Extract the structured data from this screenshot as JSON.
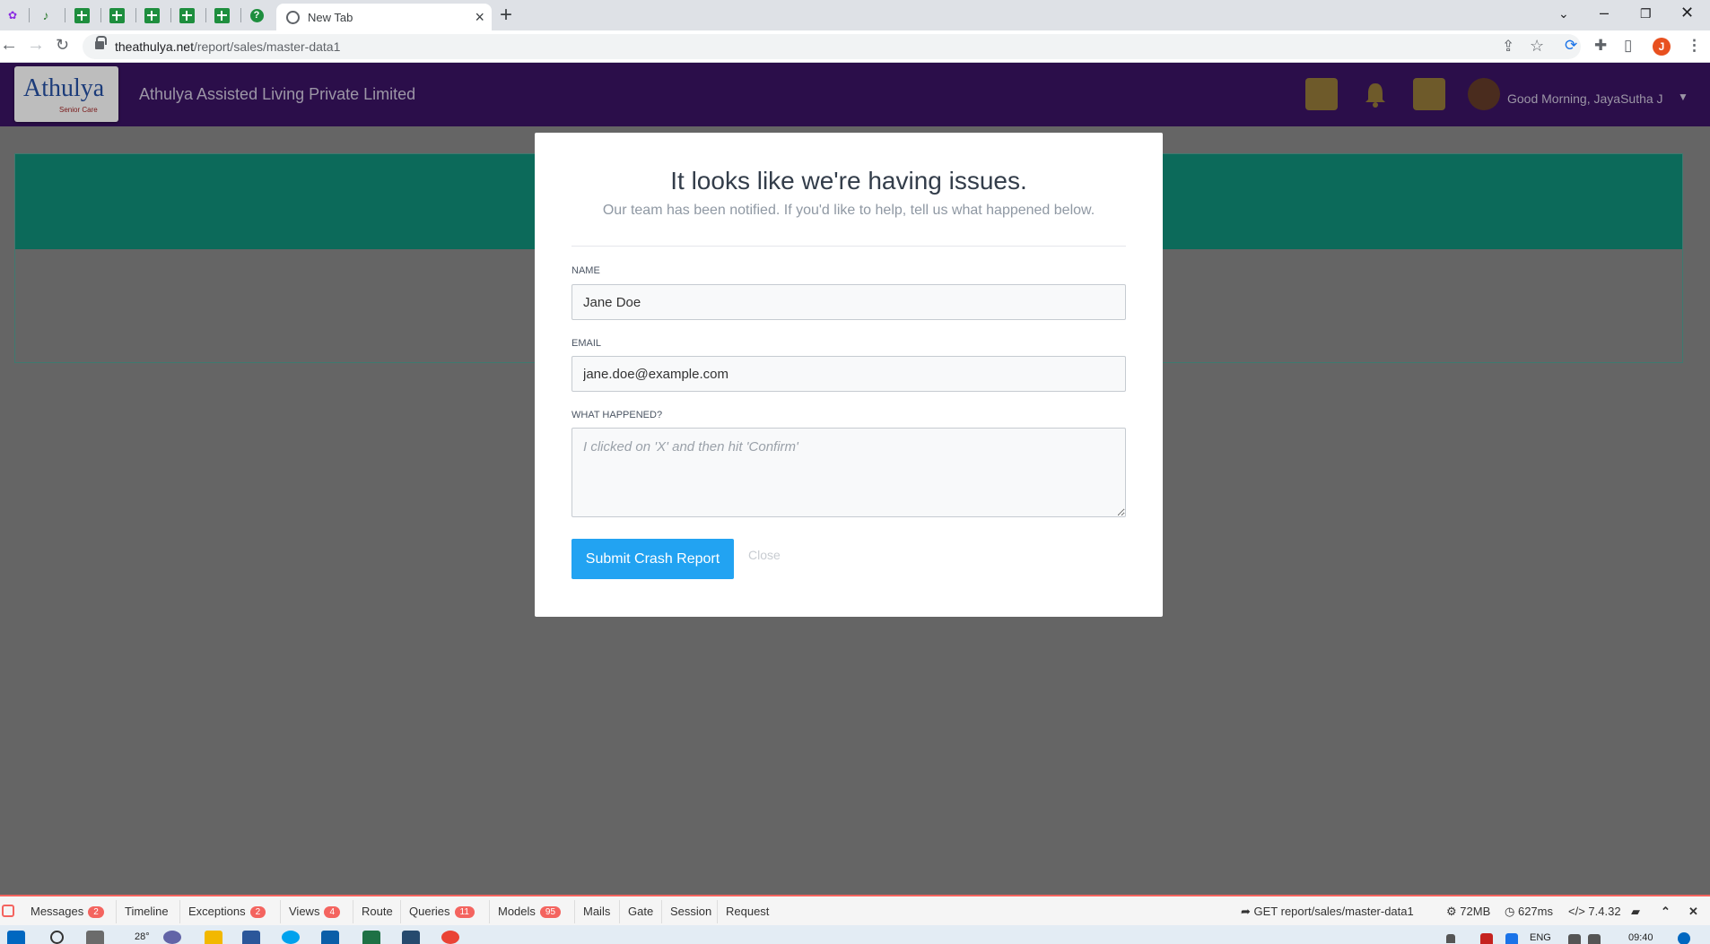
{
  "browser": {
    "active_tab_title": "New Tab",
    "url_host": "theathulya.net",
    "url_path": "/report/sales/master-data1",
    "profile_initial": "J"
  },
  "app": {
    "logo_text": "Athulya",
    "logo_subtext": "Senior Care",
    "company_name": "Athulya Assisted Living Private Limited",
    "greeting": "Good Morning, JayaSutha J"
  },
  "modal": {
    "title": "It looks like we're having issues.",
    "subtitle": "Our team has been notified. If you'd like to help, tell us what happened below.",
    "name_label": "Name",
    "name_value": "Jane Doe",
    "email_label": "Email",
    "email_value": "jane.doe@example.com",
    "comments_label": "What happened?",
    "comments_placeholder": "I clicked on 'X' and then hit 'Confirm'",
    "submit_label": "Submit Crash Report",
    "close_label": "Close"
  },
  "debugbar": {
    "tabs": [
      {
        "label": "Messages",
        "count": "2"
      },
      {
        "label": "Timeline",
        "count": ""
      },
      {
        "label": "Exceptions",
        "count": "2"
      },
      {
        "label": "Views",
        "count": "4"
      },
      {
        "label": "Route",
        "count": ""
      },
      {
        "label": "Queries",
        "count": "11"
      },
      {
        "label": "Models",
        "count": "95"
      },
      {
        "label": "Mails",
        "count": ""
      },
      {
        "label": "Gate",
        "count": ""
      },
      {
        "label": "Session",
        "count": ""
      },
      {
        "label": "Request",
        "count": ""
      }
    ],
    "request": "GET report/sales/master-data1",
    "memory": "72MB",
    "time": "627ms",
    "php_version": "7.4.32"
  },
  "taskbar": {
    "temperature": "28°",
    "language": "ENG",
    "clock": "09:40"
  },
  "colors": {
    "header_bg": "#2b0e4a",
    "card_head": "#0c6a5a",
    "submit_bg": "#22a3f2",
    "badge_bg": "#f4645f"
  }
}
